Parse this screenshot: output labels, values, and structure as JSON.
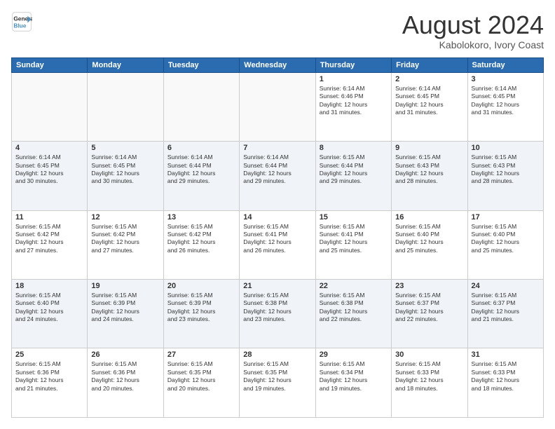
{
  "header": {
    "logo_line1": "General",
    "logo_line2": "Blue",
    "month_year": "August 2024",
    "location": "Kabolokoro, Ivory Coast"
  },
  "weekdays": [
    "Sunday",
    "Monday",
    "Tuesday",
    "Wednesday",
    "Thursday",
    "Friday",
    "Saturday"
  ],
  "rows": [
    [
      {
        "day": "",
        "info": ""
      },
      {
        "day": "",
        "info": ""
      },
      {
        "day": "",
        "info": ""
      },
      {
        "day": "",
        "info": ""
      },
      {
        "day": "1",
        "info": "Sunrise: 6:14 AM\nSunset: 6:46 PM\nDaylight: 12 hours\nand 31 minutes."
      },
      {
        "day": "2",
        "info": "Sunrise: 6:14 AM\nSunset: 6:45 PM\nDaylight: 12 hours\nand 31 minutes."
      },
      {
        "day": "3",
        "info": "Sunrise: 6:14 AM\nSunset: 6:45 PM\nDaylight: 12 hours\nand 31 minutes."
      }
    ],
    [
      {
        "day": "4",
        "info": "Sunrise: 6:14 AM\nSunset: 6:45 PM\nDaylight: 12 hours\nand 30 minutes."
      },
      {
        "day": "5",
        "info": "Sunrise: 6:14 AM\nSunset: 6:45 PM\nDaylight: 12 hours\nand 30 minutes."
      },
      {
        "day": "6",
        "info": "Sunrise: 6:14 AM\nSunset: 6:44 PM\nDaylight: 12 hours\nand 29 minutes."
      },
      {
        "day": "7",
        "info": "Sunrise: 6:14 AM\nSunset: 6:44 PM\nDaylight: 12 hours\nand 29 minutes."
      },
      {
        "day": "8",
        "info": "Sunrise: 6:15 AM\nSunset: 6:44 PM\nDaylight: 12 hours\nand 29 minutes."
      },
      {
        "day": "9",
        "info": "Sunrise: 6:15 AM\nSunset: 6:43 PM\nDaylight: 12 hours\nand 28 minutes."
      },
      {
        "day": "10",
        "info": "Sunrise: 6:15 AM\nSunset: 6:43 PM\nDaylight: 12 hours\nand 28 minutes."
      }
    ],
    [
      {
        "day": "11",
        "info": "Sunrise: 6:15 AM\nSunset: 6:42 PM\nDaylight: 12 hours\nand 27 minutes."
      },
      {
        "day": "12",
        "info": "Sunrise: 6:15 AM\nSunset: 6:42 PM\nDaylight: 12 hours\nand 27 minutes."
      },
      {
        "day": "13",
        "info": "Sunrise: 6:15 AM\nSunset: 6:42 PM\nDaylight: 12 hours\nand 26 minutes."
      },
      {
        "day": "14",
        "info": "Sunrise: 6:15 AM\nSunset: 6:41 PM\nDaylight: 12 hours\nand 26 minutes."
      },
      {
        "day": "15",
        "info": "Sunrise: 6:15 AM\nSunset: 6:41 PM\nDaylight: 12 hours\nand 25 minutes."
      },
      {
        "day": "16",
        "info": "Sunrise: 6:15 AM\nSunset: 6:40 PM\nDaylight: 12 hours\nand 25 minutes."
      },
      {
        "day": "17",
        "info": "Sunrise: 6:15 AM\nSunset: 6:40 PM\nDaylight: 12 hours\nand 25 minutes."
      }
    ],
    [
      {
        "day": "18",
        "info": "Sunrise: 6:15 AM\nSunset: 6:40 PM\nDaylight: 12 hours\nand 24 minutes."
      },
      {
        "day": "19",
        "info": "Sunrise: 6:15 AM\nSunset: 6:39 PM\nDaylight: 12 hours\nand 24 minutes."
      },
      {
        "day": "20",
        "info": "Sunrise: 6:15 AM\nSunset: 6:39 PM\nDaylight: 12 hours\nand 23 minutes."
      },
      {
        "day": "21",
        "info": "Sunrise: 6:15 AM\nSunset: 6:38 PM\nDaylight: 12 hours\nand 23 minutes."
      },
      {
        "day": "22",
        "info": "Sunrise: 6:15 AM\nSunset: 6:38 PM\nDaylight: 12 hours\nand 22 minutes."
      },
      {
        "day": "23",
        "info": "Sunrise: 6:15 AM\nSunset: 6:37 PM\nDaylight: 12 hours\nand 22 minutes."
      },
      {
        "day": "24",
        "info": "Sunrise: 6:15 AM\nSunset: 6:37 PM\nDaylight: 12 hours\nand 21 minutes."
      }
    ],
    [
      {
        "day": "25",
        "info": "Sunrise: 6:15 AM\nSunset: 6:36 PM\nDaylight: 12 hours\nand 21 minutes."
      },
      {
        "day": "26",
        "info": "Sunrise: 6:15 AM\nSunset: 6:36 PM\nDaylight: 12 hours\nand 20 minutes."
      },
      {
        "day": "27",
        "info": "Sunrise: 6:15 AM\nSunset: 6:35 PM\nDaylight: 12 hours\nand 20 minutes."
      },
      {
        "day": "28",
        "info": "Sunrise: 6:15 AM\nSunset: 6:35 PM\nDaylight: 12 hours\nand 19 minutes."
      },
      {
        "day": "29",
        "info": "Sunrise: 6:15 AM\nSunset: 6:34 PM\nDaylight: 12 hours\nand 19 minutes."
      },
      {
        "day": "30",
        "info": "Sunrise: 6:15 AM\nSunset: 6:33 PM\nDaylight: 12 hours\nand 18 minutes."
      },
      {
        "day": "31",
        "info": "Sunrise: 6:15 AM\nSunset: 6:33 PM\nDaylight: 12 hours\nand 18 minutes."
      }
    ]
  ]
}
